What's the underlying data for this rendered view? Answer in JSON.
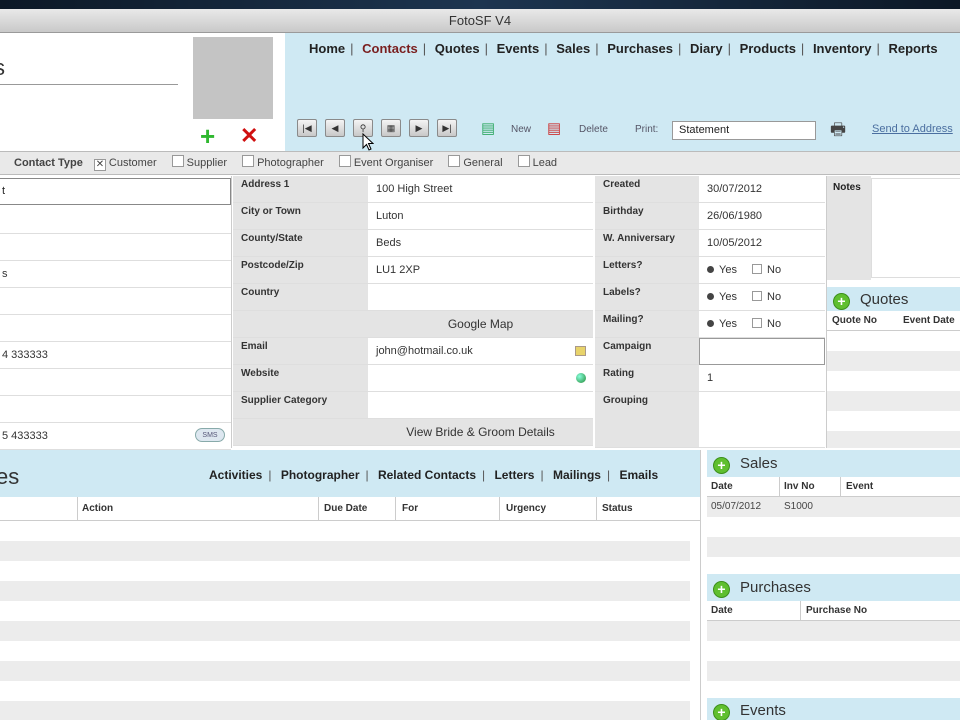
{
  "window": {
    "title": "FotoSF V4"
  },
  "header": {
    "name_fragment": "s",
    "nav": [
      "Home",
      "Contacts",
      "Quotes",
      "Events",
      "Sales",
      "Purchases",
      "Diary",
      "Products",
      "Inventory",
      "Reports"
    ],
    "active_nav": "Contacts",
    "toolbar": {
      "new_label": "New",
      "delete_label": "Delete",
      "print_label": "Print:",
      "print_value": "Statement",
      "send_label": "Send to Address"
    }
  },
  "contact_type": {
    "label": "Contact Type",
    "options": [
      {
        "label": "Customer",
        "checked": true
      },
      {
        "label": "Supplier",
        "checked": false
      },
      {
        "label": "Photographer",
        "checked": false
      },
      {
        "label": "Event Organiser",
        "checked": false
      },
      {
        "label": "General",
        "checked": false
      },
      {
        "label": "Lead",
        "checked": false
      }
    ]
  },
  "left_fields": {
    "first": "t",
    "row4": "s",
    "phone1": "4 333333",
    "phone2": "5 433333",
    "sms": "SMS"
  },
  "address": {
    "address1_label": "Address 1",
    "address1": "100 High Street",
    "city_label": "City or Town",
    "city": "Luton",
    "county_label": "County/State",
    "county": "Beds",
    "postcode_label": "Postcode/Zip",
    "postcode": "LU1 2XP",
    "country_label": "Country",
    "country": "",
    "google_map": "Google Map",
    "email_label": "Email",
    "email": "john@hotmail.co.uk",
    "website_label": "Website",
    "website": "",
    "supplier_cat_label": "Supplier Category",
    "supplier_cat": "",
    "bride_groom": "View Bride & Groom Details"
  },
  "dates": {
    "created_label": "Created",
    "created": "30/07/2012",
    "birthday_label": "Birthday",
    "birthday": "26/06/1980",
    "anniv_label": "W. Anniversary",
    "anniv": "10/05/2012",
    "letters_label": "Letters?",
    "labels_label": "Labels?",
    "mailing_label": "Mailing?",
    "yes": "Yes",
    "no": "No",
    "campaign_label": "Campaign",
    "campaign": "",
    "rating_label": "Rating",
    "rating": "1",
    "grouping_label": "Grouping",
    "grouping": ""
  },
  "notes": {
    "label": "Notes"
  },
  "quotes": {
    "title": "Quotes",
    "cols": [
      "Quote No",
      "Event Date"
    ]
  },
  "activities": {
    "title_fragment": "es",
    "links": [
      "Activities",
      "Photographer",
      "Related Contacts",
      "Letters",
      "Mailings",
      "Emails"
    ],
    "cols": [
      "Action",
      "Due Date",
      "For",
      "Urgency",
      "Status"
    ]
  },
  "sales": {
    "title": "Sales",
    "cols": [
      "Date",
      "Inv No",
      "Event"
    ],
    "rows": [
      {
        "date": "05/07/2012",
        "inv": "S1000",
        "event": ""
      }
    ]
  },
  "purchases": {
    "title": "Purchases",
    "cols": [
      "Date",
      "Purchase No"
    ]
  },
  "events": {
    "title": "Events"
  },
  "colors": {
    "accent_blue": "#cfe9f3",
    "add_green": "#5fbf2f",
    "delete_red": "#d01010"
  }
}
